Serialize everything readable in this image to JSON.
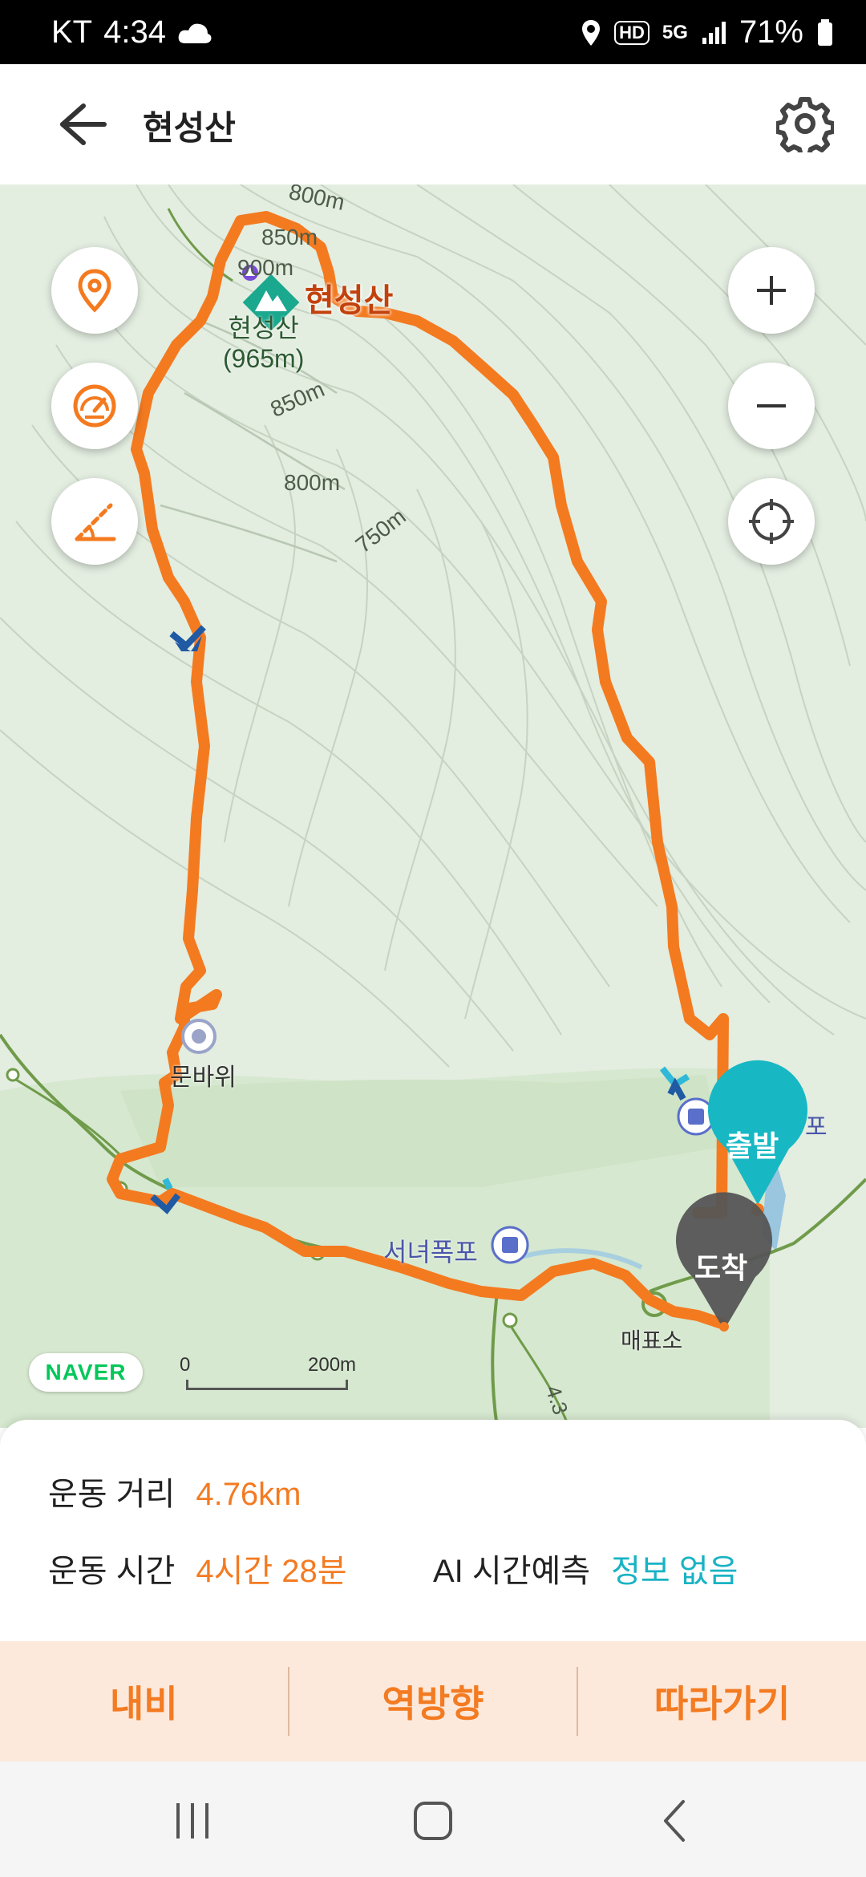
{
  "status_bar": {
    "carrier": "KT",
    "time": "4:34",
    "network": "5G",
    "hd": "HD",
    "battery": "71%"
  },
  "header": {
    "title": "현성산",
    "back_icon": "arrow-left-icon",
    "settings_icon": "gear-icon"
  },
  "map": {
    "peak_name": "현성산",
    "peak_label_line1": "현성산",
    "peak_label_line2": "(965m)",
    "contours": [
      "800m",
      "850m",
      "850m",
      "800m",
      "750m",
      "900m"
    ],
    "places": [
      "서녀폭포",
      "매표소",
      "문바위",
      "포",
      "4.3"
    ],
    "markers": {
      "start": "출발",
      "end": "도착"
    },
    "naver_logo": "NAVER",
    "scale": {
      "zero": "0",
      "max": "200m"
    },
    "controls": [
      "location-pin-icon",
      "speedometer-icon",
      "slope-icon",
      "zoom-in-icon",
      "zoom-out-icon",
      "locate-icon"
    ],
    "route_color": "#f47a20",
    "start_color": "#17b8c4",
    "end_color": "#555555"
  },
  "stats": {
    "distance_label": "운동 거리",
    "distance_value": "4.76km",
    "time_label": "운동 시간",
    "time_value": "4시간 28분",
    "ai_label": "AI 시간예측",
    "ai_value": "정보 없음"
  },
  "actions": {
    "navigate": "내비",
    "reverse": "역방향",
    "follow": "따라가기"
  },
  "nav_bar": [
    "recents-icon",
    "home-icon",
    "back-icon"
  ]
}
